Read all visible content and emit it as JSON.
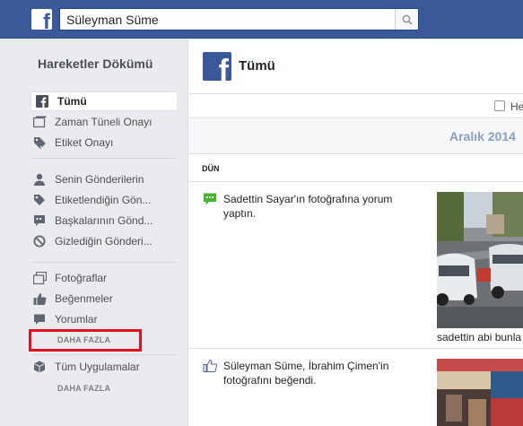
{
  "topbar": {
    "logo_glyph": "f",
    "search_value": "Süleyman Süme",
    "colors": {
      "bar": "#3b5998"
    }
  },
  "sidebar": {
    "title": "Hareketler Dökümü",
    "groups": [
      [
        {
          "label": "Tümü",
          "icon": "facebook-icon",
          "active": true
        },
        {
          "label": "Zaman Tüneli Onayı",
          "icon": "timeline-icon"
        },
        {
          "label": "Etiket Onayı",
          "icon": "tag-check-icon"
        }
      ],
      [
        {
          "label": "Senin Gönderilerin",
          "icon": "person-icon"
        },
        {
          "label": "Etiketlendiğin Gön...",
          "icon": "tag-icon"
        },
        {
          "label": "Başkalarının Gönd...",
          "icon": "comment-bubble-icon"
        },
        {
          "label": "Gizlediğin Gönderi...",
          "icon": "hidden-icon"
        }
      ],
      [
        {
          "label": "Fotoğraflar",
          "icon": "photos-icon"
        },
        {
          "label": "Beğenmeler",
          "icon": "thumbs-up-icon"
        },
        {
          "label": "Yorumlar",
          "icon": "comment-icon"
        }
      ]
    ],
    "more_label_1": "DAHA FAZLA",
    "apps_label": "Tüm Uygulamalar",
    "more_label_2": "DAHA FAZLA",
    "highlight_color": "#e0141e"
  },
  "main": {
    "title": "Tümü",
    "filter_label": "He",
    "month": "Aralık 2014",
    "day": "DÜN",
    "activities": [
      {
        "icon": "comment-icon",
        "text": "Sadettin Sayar'ın fotoğrafına yorum yaptın.",
        "caption": "sadettin abi bunla"
      },
      {
        "icon": "like-icon",
        "text": "Süleyman Süme, İbrahim Çimen'in fotoğrafını beğendi.",
        "caption": ""
      }
    ]
  }
}
